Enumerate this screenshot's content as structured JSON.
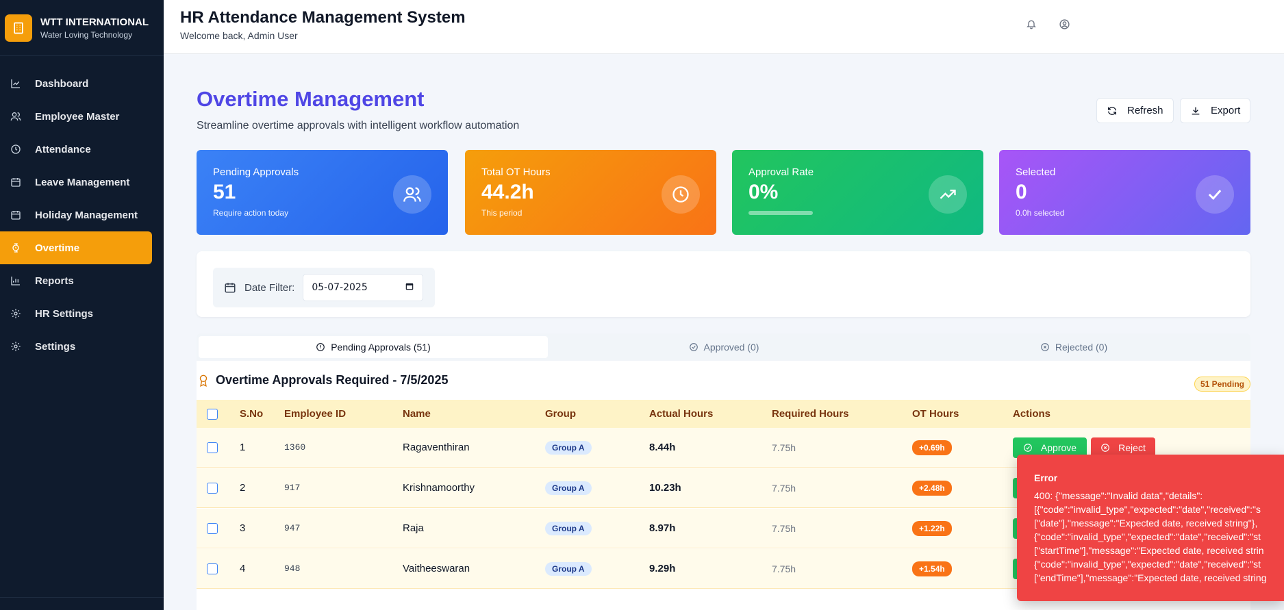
{
  "brand": {
    "name": "WTT INTERNATIONAL",
    "tagline": "Water Loving Technology"
  },
  "sidebar": {
    "items": [
      {
        "label": "Dashboard",
        "icon": "chart-line-icon"
      },
      {
        "label": "Employee Master",
        "icon": "users-icon"
      },
      {
        "label": "Attendance",
        "icon": "clock-icon"
      },
      {
        "label": "Leave Management",
        "icon": "calendar-icon"
      },
      {
        "label": "Holiday Management",
        "icon": "calendar-icon"
      },
      {
        "label": "Overtime",
        "icon": "watch-icon",
        "active": true
      },
      {
        "label": "Reports",
        "icon": "bar-chart-icon"
      },
      {
        "label": "HR Settings",
        "icon": "gear-icon"
      },
      {
        "label": "Settings",
        "icon": "gear-icon"
      }
    ]
  },
  "header": {
    "title": "HR Attendance Management System",
    "subtitle": "Welcome back, Admin User"
  },
  "page": {
    "title": "Overtime Management",
    "subtitle": "Streamline overtime approvals with intelligent workflow automation",
    "refresh_label": "Refresh",
    "export_label": "Export"
  },
  "stats": {
    "pending": {
      "label": "Pending Approvals",
      "value": "51",
      "sub": "Require action today",
      "color": "#3b82f6"
    },
    "ot_hours": {
      "label": "Total OT Hours",
      "value": "44.2h",
      "sub": "This period",
      "color": "#f59e0b"
    },
    "approval": {
      "label": "Approval Rate",
      "value": "0%",
      "progress": 0,
      "color": "#22c55e"
    },
    "selected": {
      "label": "Selected",
      "value": "0",
      "sub": "0.0h selected",
      "color": "#8b5cf6"
    }
  },
  "filter": {
    "label": "Date Filter:",
    "value": "05-07-2025"
  },
  "tabs": [
    {
      "label": "Pending Approvals (51)",
      "icon": "alert-circle-icon",
      "active": true
    },
    {
      "label": "Approved (0)",
      "icon": "check-circle-icon"
    },
    {
      "label": "Rejected (0)",
      "icon": "x-circle-icon"
    }
  ],
  "table": {
    "title": "Overtime Approvals Required - 7/5/2025",
    "badge": "51 Pending",
    "columns": [
      "S.No",
      "Employee ID",
      "Name",
      "Group",
      "Actual Hours",
      "Required Hours",
      "OT Hours",
      "Actions"
    ],
    "rows": [
      {
        "sno": "1",
        "emp_id": "1360",
        "name": "Ragaventhiran",
        "group": "Group A",
        "actual": "8.44h",
        "required": "7.75h",
        "ot": "+0.69h"
      },
      {
        "sno": "2",
        "emp_id": "917",
        "name": "Krishnamoorthy",
        "group": "Group A",
        "actual": "10.23h",
        "required": "7.75h",
        "ot": "+2.48h"
      },
      {
        "sno": "3",
        "emp_id": "947",
        "name": "Raja",
        "group": "Group A",
        "actual": "8.97h",
        "required": "7.75h",
        "ot": "+1.22h"
      },
      {
        "sno": "4",
        "emp_id": "948",
        "name": "Vaitheeswaran",
        "group": "Group A",
        "actual": "9.29h",
        "required": "7.75h",
        "ot": "+1.54h"
      }
    ],
    "approve_label": "Approve",
    "reject_label": "Reject"
  },
  "toast": {
    "title": "Error",
    "lines": [
      "400: {\"message\":\"Invalid data\",\"details\":",
      "[{\"code\":\"invalid_type\",\"expected\":\"date\",\"received\":\"s",
      "[\"date\"],\"message\":\"Expected date, received string\"},",
      "{\"code\":\"invalid_type\",\"expected\":\"date\",\"received\":\"st",
      "[\"startTime\"],\"message\":\"Expected date, received strin",
      "{\"code\":\"invalid_type\",\"expected\":\"date\",\"received\":\"st",
      "[\"endTime\"],\"message\":\"Expected date, received string"
    ]
  }
}
